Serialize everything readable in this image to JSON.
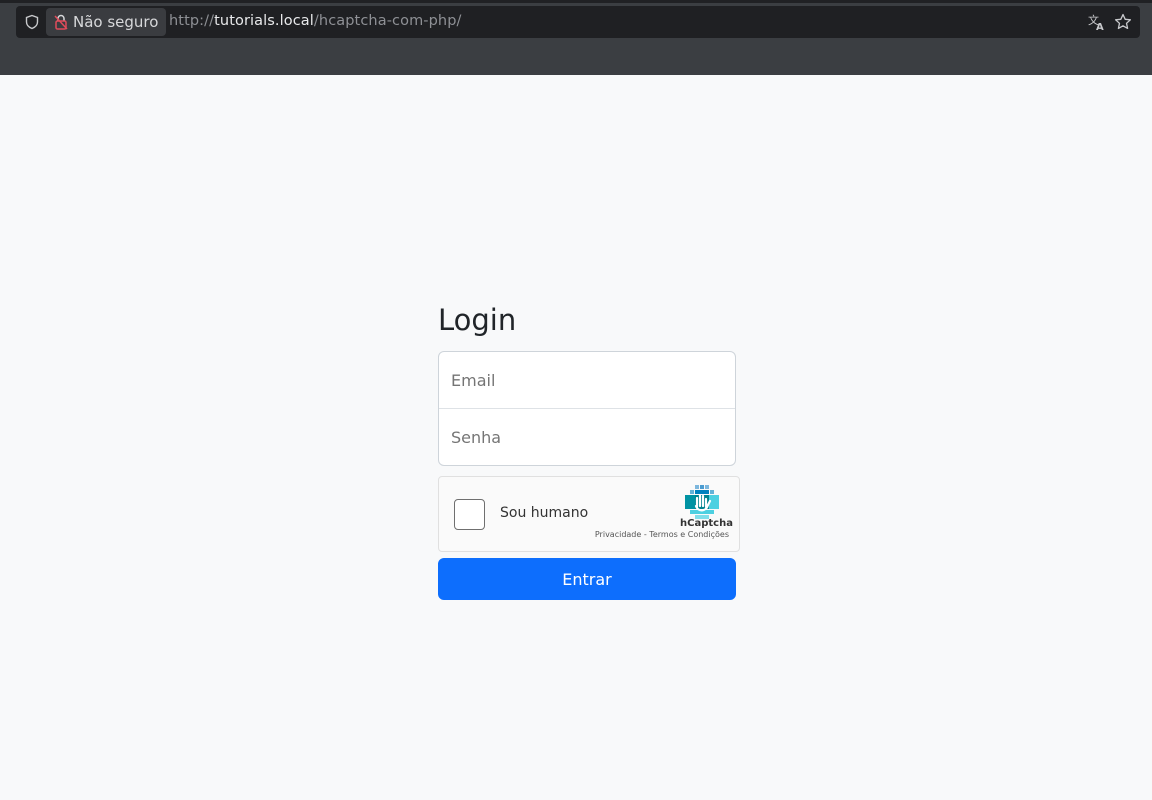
{
  "browser": {
    "security_label": "Não seguro",
    "url_scheme": "http://",
    "url_host": "tutorials.local",
    "url_path": "/hcaptcha-com-php/"
  },
  "login": {
    "title": "Login",
    "email_placeholder": "Email",
    "password_placeholder": "Senha",
    "submit_label": "Entrar"
  },
  "captcha": {
    "checkbox_label": "Sou humano",
    "brand": "hCaptcha",
    "privacy_link": "Privacidade",
    "separator": " - ",
    "terms_link": "Termos e Condições"
  },
  "colors": {
    "primary": "#0d6efd",
    "page_bg": "#f8f9fa",
    "chrome_bg": "#3b3e42"
  }
}
